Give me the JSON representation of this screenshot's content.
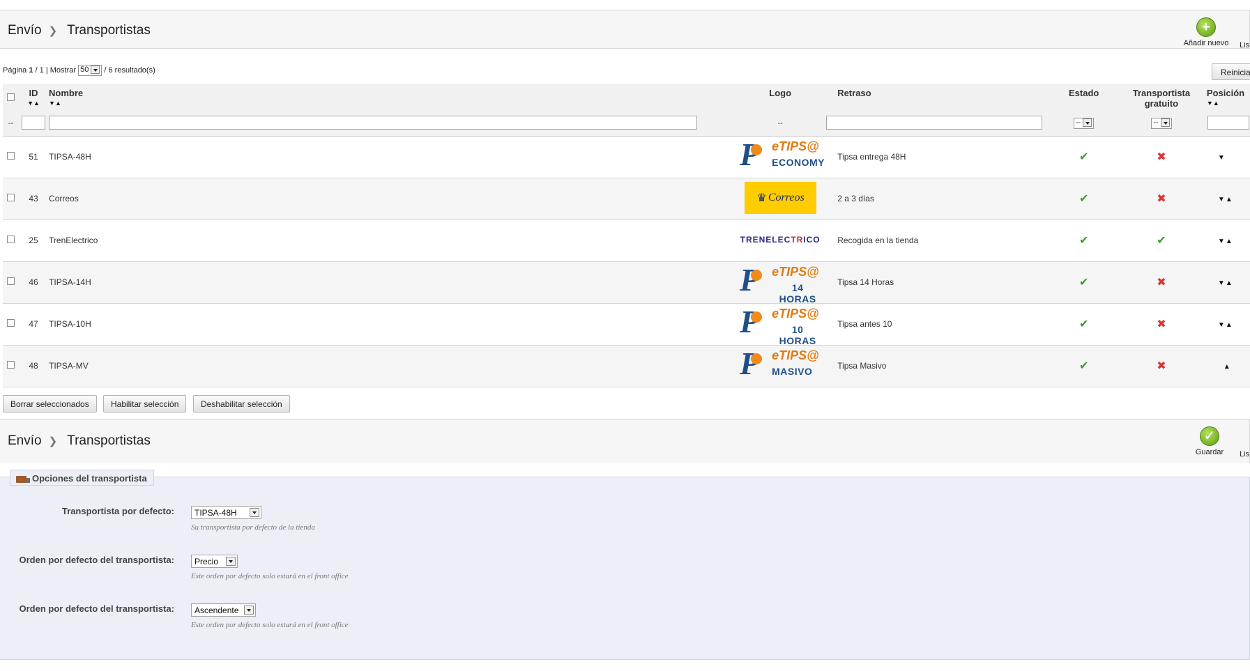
{
  "top_toolbar": {
    "breadcrumb": {
      "section": "Envío",
      "page": "Transportistas"
    },
    "add_new_label": "Añadir nuevo",
    "list_label": "Lis"
  },
  "pager": {
    "page_label": "Página",
    "current_page": "1",
    "total_pages": "/ 1",
    "show_label": "| Mostrar",
    "per_page": "50",
    "results_text": "/ 6 resultado(s)"
  },
  "reset_label": "Reinicia",
  "table": {
    "headers": {
      "id": "ID",
      "name": "Nombre",
      "logo": "Logo",
      "delay": "Retraso",
      "status": "Estado",
      "free": "Transportista gratuito",
      "position": "Posición"
    },
    "filter": {
      "select_all": "--",
      "logo": "--",
      "status": "--",
      "free": "--"
    },
    "rows": [
      {
        "id": "51",
        "name": "TIPSA-48H",
        "logo": "tipsa",
        "logo_word": "eTIPS@",
        "logo_sub": "ECONOMY",
        "delay": "Tipsa entrega 48H",
        "status": true,
        "free": false,
        "position": "▼"
      },
      {
        "id": "43",
        "name": "Correos",
        "logo": "correos",
        "logo_word": "CORREOS",
        "logo_sub": "",
        "delay": "2 a 3 días",
        "status": true,
        "free": false,
        "position": "▼▲"
      },
      {
        "id": "25",
        "name": "TrenElectrico",
        "logo": "tren",
        "logo_word": "TRENELECTRICO",
        "logo_sub": "",
        "delay": "Recogida en la tienda",
        "status": true,
        "free": true,
        "position": "▼▲"
      },
      {
        "id": "46",
        "name": "TIPSA-14H",
        "logo": "tipsa",
        "logo_word": "eTIPS@",
        "logo_sub": "14 HORAS",
        "delay": "Tipsa 14 Horas",
        "status": true,
        "free": false,
        "position": "▼▲"
      },
      {
        "id": "47",
        "name": "TIPSA-10H",
        "logo": "tipsa",
        "logo_word": "eTIPS@",
        "logo_sub": "10 HORAS",
        "delay": "Tipsa antes 10",
        "status": true,
        "free": false,
        "position": "▼▲"
      },
      {
        "id": "48",
        "name": "TIPSA-MV",
        "logo": "tipsa",
        "logo_word": "eTIPS@",
        "logo_sub": "MASIVO",
        "delay": "Tipsa Masivo",
        "status": true,
        "free": false,
        "position": "▲"
      }
    ]
  },
  "bulk_actions": {
    "delete": "Borrar seleccionados",
    "enable": "Habilitar selección",
    "disable": "Deshabilitar selección"
  },
  "bottom_toolbar": {
    "breadcrumb": {
      "section": "Envío",
      "page": "Transportistas"
    },
    "save_label": "Guardar",
    "list_label": "Lis"
  },
  "options": {
    "legend": "Opciones del transportista",
    "default_carrier": {
      "label": "Transportista por defecto:",
      "value": "TIPSA-48H",
      "help": "Su transportista por defecto de la tienda"
    },
    "order_by": {
      "label": "Orden por defecto del transportista:",
      "value": "Precio",
      "help": "Este orden por defecto solo estará en el front office"
    },
    "order_way": {
      "label": "Orden por defecto del transportista:",
      "value": "Ascendente",
      "help": "Este orden por defecto solo estará en el front office"
    }
  },
  "colors": {
    "ok": "#3d9a2b",
    "ko": "#e03232",
    "accent": "#5c9a16"
  },
  "icons": {
    "check": "✔",
    "cross": "✖",
    "plus": "+",
    "save": "✓"
  }
}
